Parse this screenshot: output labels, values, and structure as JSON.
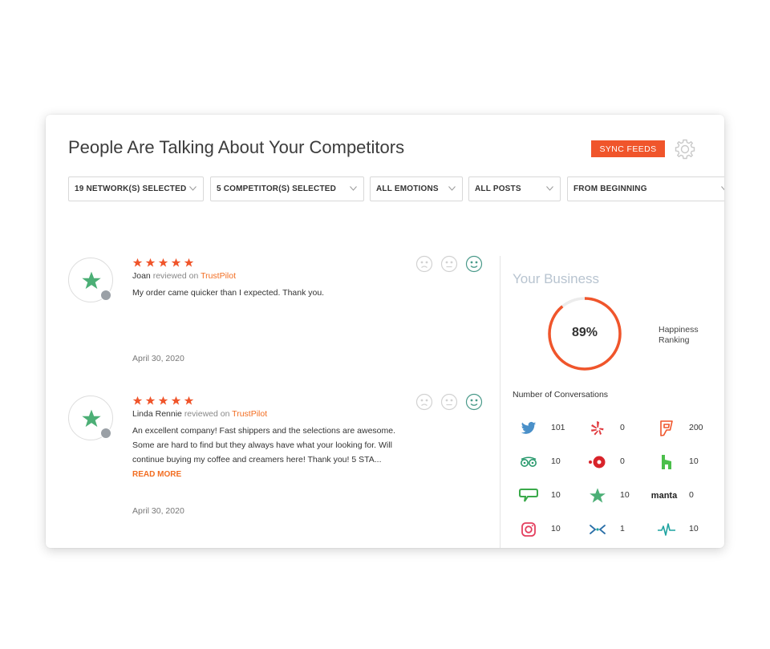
{
  "header": {
    "title": "People Are Talking About Your Competitors",
    "sync_label": "SYNC FEEDS"
  },
  "filters": [
    {
      "label": "19 NETWORK(S) SELECTED"
    },
    {
      "label": "5 COMPETITOR(S) SELECTED"
    },
    {
      "label": "ALL EMOTIONS"
    },
    {
      "label": "ALL POSTS"
    },
    {
      "label": "FROM BEGINNING"
    }
  ],
  "reviews": [
    {
      "author": "Joan",
      "reviewed_on": "reviewed on",
      "source": "TrustPilot",
      "rating": 5,
      "text": "My order came quicker than I expected. Thank you.",
      "read_more": "",
      "date": "April 30, 2020"
    },
    {
      "author": "Linda Rennie",
      "reviewed_on": "reviewed on",
      "source": "TrustPilot",
      "rating": 5,
      "text": "An excellent company! Fast shippers and the selections are awesome. Some are hard to find but they always have what your looking for. Will continue buying my coffee and creamers here! Thank you! 5 STA...",
      "read_more": "READ MORE",
      "date": "April 30, 2020"
    }
  ],
  "business": {
    "title": "Your Business",
    "happiness_percent": 89,
    "happiness_display": "89%",
    "happiness_label": "Happiness Ranking",
    "conversations_title": "Number of Conversations",
    "networks": [
      {
        "icon": "twitter-icon",
        "count": "101"
      },
      {
        "icon": "yelp-icon",
        "count": "0"
      },
      {
        "icon": "foursquare-icon",
        "count": "200"
      },
      {
        "icon": "tripadvisor-icon",
        "count": "10"
      },
      {
        "icon": "opentable-icon",
        "count": "0"
      },
      {
        "icon": "houzz-icon",
        "count": "10"
      },
      {
        "icon": "citysearch-icon",
        "count": "10"
      },
      {
        "icon": "trustpilot-icon",
        "count": "10"
      },
      {
        "icon": "manta-icon",
        "label": "manta",
        "count": "0"
      },
      {
        "icon": "instagram-icon",
        "count": "10"
      },
      {
        "icon": "ratings-icon",
        "count": "1"
      },
      {
        "icon": "healthgrades-icon",
        "count": "10"
      }
    ]
  },
  "colors": {
    "accent": "#f0552b",
    "link": "#f26d21",
    "star": "#f0552b",
    "trustpilot_green": "#4caf76",
    "business_title": "#b8c4d0"
  }
}
